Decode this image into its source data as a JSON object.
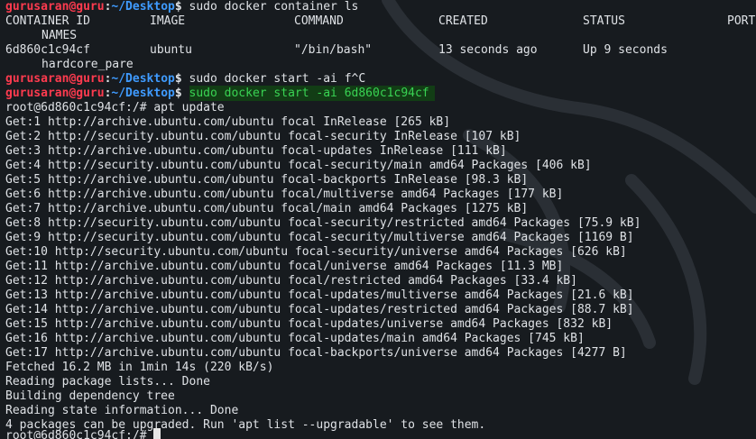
{
  "prompt": {
    "user": "gurusaran@guru",
    "separator": ":",
    "path": "~/Desktop",
    "symbol": "$"
  },
  "commands": [
    " sudo docker container ls",
    " sudo docker start -ai f^C",
    "sudo docker start -ai 6d860c1c94cf"
  ],
  "container_table": {
    "headers": [
      "CONTAINER ID",
      "IMAGE",
      "COMMAND",
      "CREATED",
      "STATUS",
      "PORT"
    ],
    "header_names": "NAMES",
    "row": [
      "6d860c1c94cf",
      "ubuntu",
      "\"/bin/bash\"",
      "13 seconds ago",
      "Up 9 seconds"
    ],
    "row_name": "hardcore_pare"
  },
  "root_prompt": "root@6d860c1c94cf:/# apt update",
  "output_lines": [
    "Get:1 http://archive.ubuntu.com/ubuntu focal InRelease [265 kB]",
    "Get:2 http://security.ubuntu.com/ubuntu focal-security InRelease [107 kB]",
    "Get:3 http://archive.ubuntu.com/ubuntu focal-updates InRelease [111 kB]",
    "Get:4 http://security.ubuntu.com/ubuntu focal-security/main amd64 Packages [406 kB]",
    "Get:5 http://archive.ubuntu.com/ubuntu focal-backports InRelease [98.3 kB]",
    "Get:6 http://archive.ubuntu.com/ubuntu focal/multiverse amd64 Packages [177 kB]",
    "Get:7 http://archive.ubuntu.com/ubuntu focal/main amd64 Packages [1275 kB]",
    "Get:8 http://security.ubuntu.com/ubuntu focal-security/restricted amd64 Packages [75.9 kB]",
    "Get:9 http://security.ubuntu.com/ubuntu focal-security/multiverse amd64 Packages [1169 B]",
    "Get:10 http://security.ubuntu.com/ubuntu focal-security/universe amd64 Packages [626 kB]",
    "Get:11 http://archive.ubuntu.com/ubuntu focal/universe amd64 Packages [11.3 MB]",
    "Get:12 http://archive.ubuntu.com/ubuntu focal/restricted amd64 Packages [33.4 kB]",
    "Get:13 http://archive.ubuntu.com/ubuntu focal-updates/multiverse amd64 Packages [21.6 kB]",
    "Get:14 http://archive.ubuntu.com/ubuntu focal-updates/restricted amd64 Packages [88.7 kB]",
    "Get:15 http://archive.ubuntu.com/ubuntu focal-updates/universe amd64 Packages [832 kB]",
    "Get:16 http://archive.ubuntu.com/ubuntu focal-updates/main amd64 Packages [745 kB]",
    "Get:17 http://archive.ubuntu.com/ubuntu focal-backports/universe amd64 Packages [4277 B]",
    "Fetched 16.2 MB in 1min 14s (220 kB/s)",
    "Reading package lists... Done",
    "Building dependency tree",
    "Reading state information... Done",
    "4 packages can be upgraded. Run 'apt list --upgradable' to see them."
  ],
  "final_prompt": "root@6d860c1c94cf:/# ",
  "colors": {
    "background": "#171b1f",
    "user": "#ff3b4f",
    "path": "#3f9bff",
    "highlight_bg": "#123d15",
    "highlight_fg": "#39d353",
    "text": "#dfe2e6"
  },
  "icons": {
    "watermark": "kali-dragon-watermark-icon",
    "cursor": "block-cursor-icon"
  }
}
